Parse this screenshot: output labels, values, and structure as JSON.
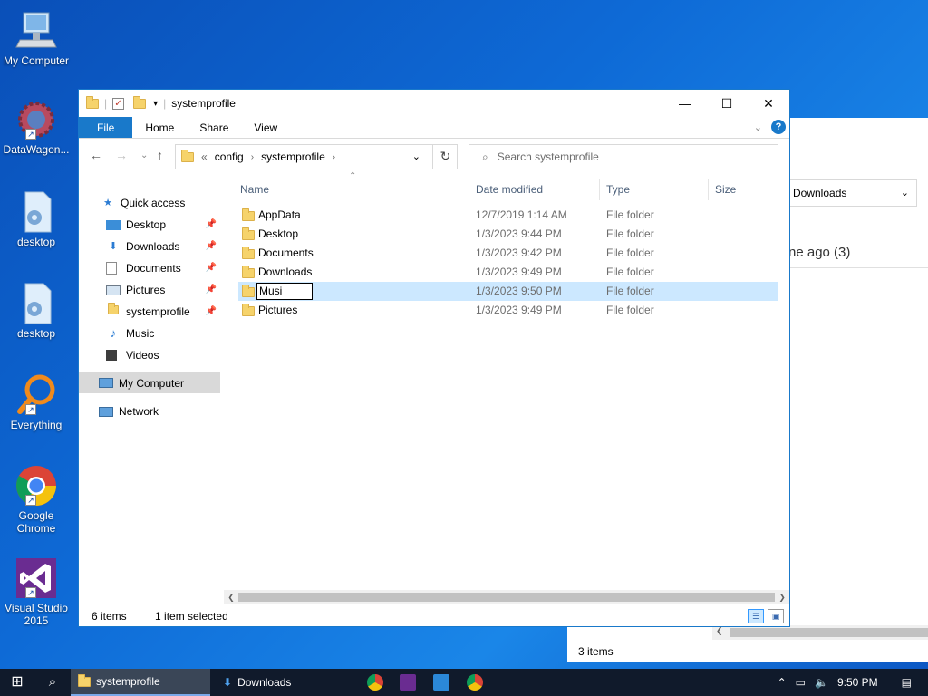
{
  "desktop": {
    "icons": [
      {
        "label": "My Computer",
        "icon": "monitor-icon"
      },
      {
        "label": "DataWagon...",
        "icon": "gear-globe-icon"
      },
      {
        "label": "desktop",
        "icon": "settings-file-icon"
      },
      {
        "label": "desktop",
        "icon": "settings-file-icon"
      },
      {
        "label": "Everything",
        "icon": "magnifier-icon"
      },
      {
        "label": "Google Chrome",
        "icon": "chrome-icon"
      },
      {
        "label": "Visual Studio 2015",
        "icon": "visual-studio-icon"
      }
    ]
  },
  "bg_window": {
    "address": "Downloads",
    "group_text": "ne ago (3)",
    "status": "3 items"
  },
  "window": {
    "title": "systemprofile",
    "tabs": [
      "File",
      "Home",
      "Share",
      "View"
    ],
    "breadcrumb": {
      "prefix": "«",
      "parts": [
        "config",
        "systemprofile"
      ]
    },
    "search_placeholder": "Search systemprofile",
    "columns": {
      "name": "Name",
      "date": "Date modified",
      "type": "Type",
      "size": "Size"
    },
    "nav": {
      "quick_access": "Quick access",
      "items": [
        {
          "label": "Desktop",
          "pinned": true,
          "icon": "desktop-icon"
        },
        {
          "label": "Downloads",
          "pinned": true,
          "icon": "download-arrow-icon"
        },
        {
          "label": "Documents",
          "pinned": true,
          "icon": "document-icon"
        },
        {
          "label": "Pictures",
          "pinned": true,
          "icon": "pictures-icon"
        },
        {
          "label": "systemprofile",
          "pinned": true,
          "icon": "folder-icon"
        },
        {
          "label": "Music",
          "pinned": false,
          "icon": "music-note-icon"
        },
        {
          "label": "Videos",
          "pinned": false,
          "icon": "film-icon"
        }
      ],
      "my_computer": "My Computer",
      "network": "Network"
    },
    "files": [
      {
        "name": "AppData",
        "date": "12/7/2019 1:14 AM",
        "type": "File folder"
      },
      {
        "name": "Desktop",
        "date": "1/3/2023 9:44 PM",
        "type": "File folder"
      },
      {
        "name": "Documents",
        "date": "1/3/2023 9:42 PM",
        "type": "File folder"
      },
      {
        "name": "Downloads",
        "date": "1/3/2023 9:49 PM",
        "type": "File folder"
      },
      {
        "name": "Musi",
        "date": "1/3/2023 9:50 PM",
        "type": "File folder",
        "renaming": true
      },
      {
        "name": "Pictures",
        "date": "1/3/2023 9:49 PM",
        "type": "File folder"
      }
    ],
    "status": {
      "count": "6 items",
      "selected": "1 item selected"
    }
  },
  "taskbar": {
    "items": [
      {
        "label": "systemprofile",
        "active": true
      },
      {
        "label": "Downloads",
        "active": false
      }
    ],
    "clock": "9:50 PM"
  },
  "colors": {
    "accent": "#1979ca",
    "selection": "#cce8ff",
    "folder": "#f6d36b",
    "taskbar": "#101a2b"
  }
}
